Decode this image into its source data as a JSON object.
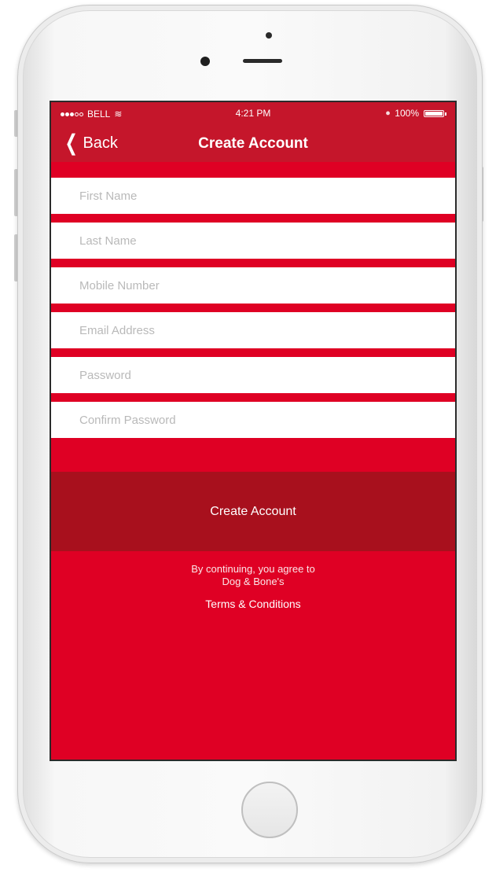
{
  "status_bar": {
    "carrier": "BELL",
    "time": "4:21 PM",
    "battery": "100%",
    "signal_bars_filled": 3,
    "signal_bars_total": 5,
    "battery_level": 1.0,
    "wifi_icon": "wifi-icon",
    "bluetooth_icon": "bluetooth-icon"
  },
  "nav": {
    "back_label": "Back",
    "back_icon": "chevron-left-icon",
    "title": "Create Account"
  },
  "form": {
    "first_name_placeholder": "First Name",
    "last_name_placeholder": "Last Name",
    "mobile_placeholder": "Mobile Number",
    "email_placeholder": "Email Address",
    "password_placeholder": "Password",
    "confirm_password_placeholder": "Confirm Password"
  },
  "actions": {
    "create_account_label": "Create Account"
  },
  "terms": {
    "line1": "By continuing, you agree to",
    "line2": "Dog & Bone's",
    "link": "Terms & Conditions"
  },
  "colors": {
    "brand_red": "#df0024",
    "nav_red": "#c5162b",
    "button_dark_red": "#a8101d"
  }
}
